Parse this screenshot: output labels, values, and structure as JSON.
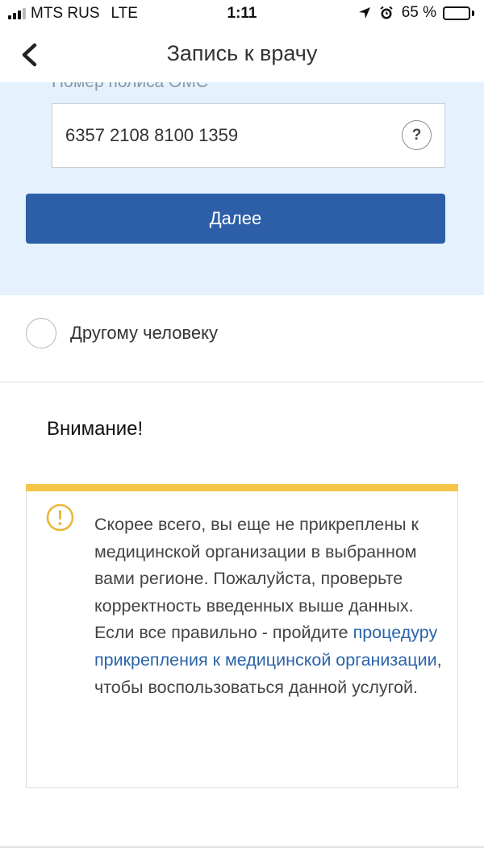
{
  "status_bar": {
    "carrier": "MTS RUS",
    "network": "LTE",
    "time": "1:11",
    "battery_text": "65 %",
    "battery_level": 0.65,
    "icons": [
      "location-arrow-icon",
      "alarm-icon"
    ]
  },
  "header": {
    "title": "Запись к врачу",
    "back_icon": "chevron-left-icon"
  },
  "form": {
    "policy_label": "Номер полиса ОМС",
    "policy_value": "6357 2108 8100 1359",
    "help_label": "?",
    "next_button": "Далее",
    "panel_color": "#e5f1fd",
    "button_color": "#2c5fa8"
  },
  "option": {
    "label": "Другому человеку"
  },
  "attention": {
    "title": "Внимание!",
    "text_before": "Скорее всего, вы еще не прикреплены к медицинской организации в выбранном вами регионе. Пожалуйста, проверьте корректность введенных выше данных. Если все правильно - пройдите ",
    "link": "процедуру прикрепления к медицинской организации",
    "text_after": ", чтобы воспользоваться данной услугой.",
    "icon": "warning-circle-icon",
    "stripe_color": "#f5c547",
    "link_color": "#2b64a9"
  }
}
